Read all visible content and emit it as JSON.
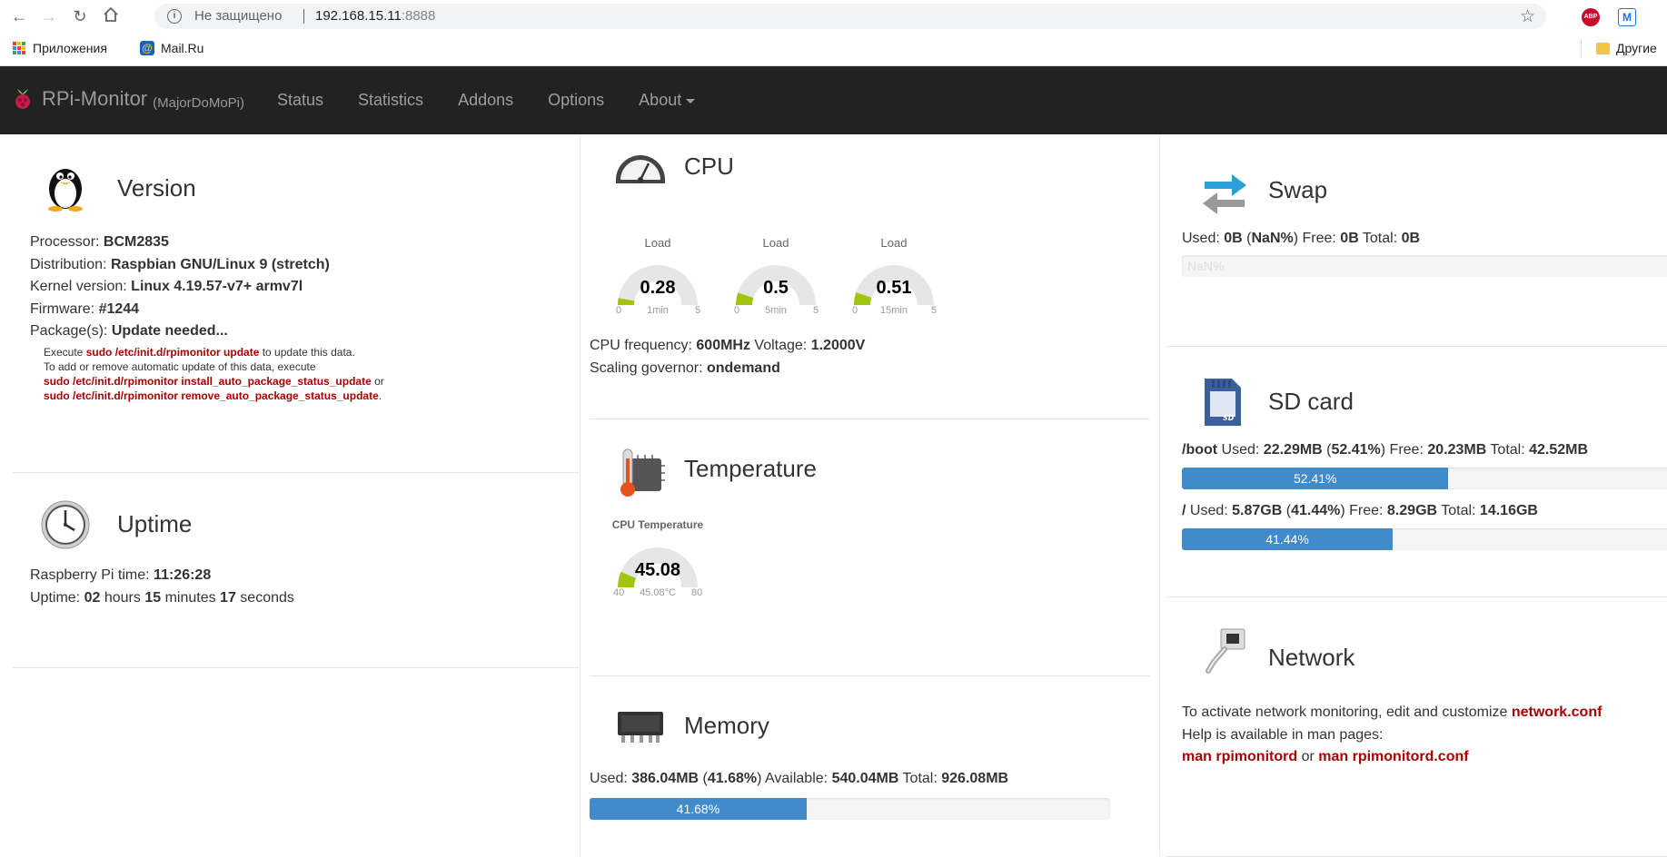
{
  "browser": {
    "security_label": "Не защищено",
    "url_host": "192.168.15.11",
    "url_port": ":8888",
    "ext_abp": "ABP",
    "ext_m": "M",
    "bookmarks": [
      {
        "label": "Приложения"
      },
      {
        "label": "Mail.Ru"
      },
      {
        "label": "Другие"
      }
    ]
  },
  "app": {
    "brand": "RPi-Monitor",
    "host": "(MajorDoMoPi)",
    "menu": [
      "Status",
      "Statistics",
      "Addons",
      "Options",
      "About"
    ]
  },
  "version": {
    "title": "Version",
    "processor_label": "Processor:",
    "processor": "BCM2835",
    "distribution_label": "Distribution:",
    "distribution": "Raspbian GNU/Linux 9 (stretch)",
    "kernel_label": "Kernel version:",
    "kernel": "Linux 4.19.57-v7+ armv7l",
    "firmware_label": "Firmware:",
    "firmware": "#1244",
    "packages_label": "Package(s):",
    "packages": "Update needed...",
    "note_execute": "Execute",
    "note_cmd_update": "sudo /etc/init.d/rpimonitor update",
    "note_to_update": "to update this data.",
    "note_line2": "To add or remove automatic update of this data, execute",
    "note_cmd_install": "sudo /etc/init.d/rpimonitor install_auto_package_status_update",
    "note_or": "or",
    "note_cmd_remove": "sudo /etc/init.d/rpimonitor remove_auto_package_status_update",
    "note_dot": "."
  },
  "uptime": {
    "title": "Uptime",
    "time_label": "Raspberry Pi time:",
    "time": "11:26:28",
    "uptime_label": "Uptime:",
    "hours": "02",
    "hours_label": "hours",
    "minutes": "15",
    "minutes_label": "minutes",
    "seconds": "17",
    "seconds_label": "seconds"
  },
  "cpu": {
    "title": "CPU",
    "gauges": [
      {
        "label": "Load",
        "value": "0.28",
        "min": "0",
        "max": "5",
        "sub": "1min",
        "fraction": 0.056
      },
      {
        "label": "Load",
        "value": "0.5",
        "min": "0",
        "max": "5",
        "sub": "5min",
        "fraction": 0.1
      },
      {
        "label": "Load",
        "value": "0.51",
        "min": "0",
        "max": "5",
        "sub": "15min",
        "fraction": 0.102
      }
    ],
    "freq_label": "CPU frequency:",
    "freq": "600MHz",
    "voltage_label": "Voltage:",
    "voltage": "1.2000V",
    "governor_label": "Scaling governor:",
    "governor": "ondemand"
  },
  "temperature": {
    "title": "Temperature",
    "gauge": {
      "label": "CPU Temperature",
      "value": "45.08",
      "min": "40",
      "max": "80",
      "sub": "45.08°C",
      "fraction": 0.127
    }
  },
  "memory": {
    "title": "Memory",
    "used_label": "Used:",
    "used": "386.04MB",
    "pct": "41.68%",
    "available_label": "Available:",
    "available": "540.04MB",
    "total_label": "Total:",
    "total": "926.08MB",
    "bar_text": "41.68%",
    "bar_fraction": 0.4168
  },
  "swap": {
    "title": "Swap",
    "used_label": "Used:",
    "used": "0B",
    "pct": "NaN%",
    "free_label": "Free:",
    "free": "0B",
    "total_label": "Total:",
    "total": "0B",
    "bar_text": "NaN%"
  },
  "sdcard": {
    "title": "SD card",
    "boot": {
      "mount": "/boot",
      "used_label": "Used:",
      "used": "22.29MB",
      "pct": "52.41%",
      "free_label": "Free:",
      "free": "20.23MB",
      "total_label": "Total:",
      "total": "42.52MB",
      "bar_text": "52.41%",
      "bar_fraction": 0.5241
    },
    "root": {
      "mount": "/",
      "used_label": "Used:",
      "used": "5.87GB",
      "pct": "41.44%",
      "free_label": "Free:",
      "free": "8.29GB",
      "total_label": "Total:",
      "total": "14.16GB",
      "bar_text": "41.44%",
      "bar_fraction": 0.4144
    }
  },
  "network": {
    "title": "Network",
    "line1": "To activate network monitoring, edit and customize",
    "link_conf": "network.conf",
    "line2": "Help is available in man pages:",
    "man1": "man rpimonitord",
    "or": "or",
    "man2": "man rpimonitord.conf"
  },
  "colors": {
    "accent_blue": "#428bca",
    "navbar": "#222222",
    "link_red": "#aa0000",
    "gauge_green": "#a0c50e"
  }
}
